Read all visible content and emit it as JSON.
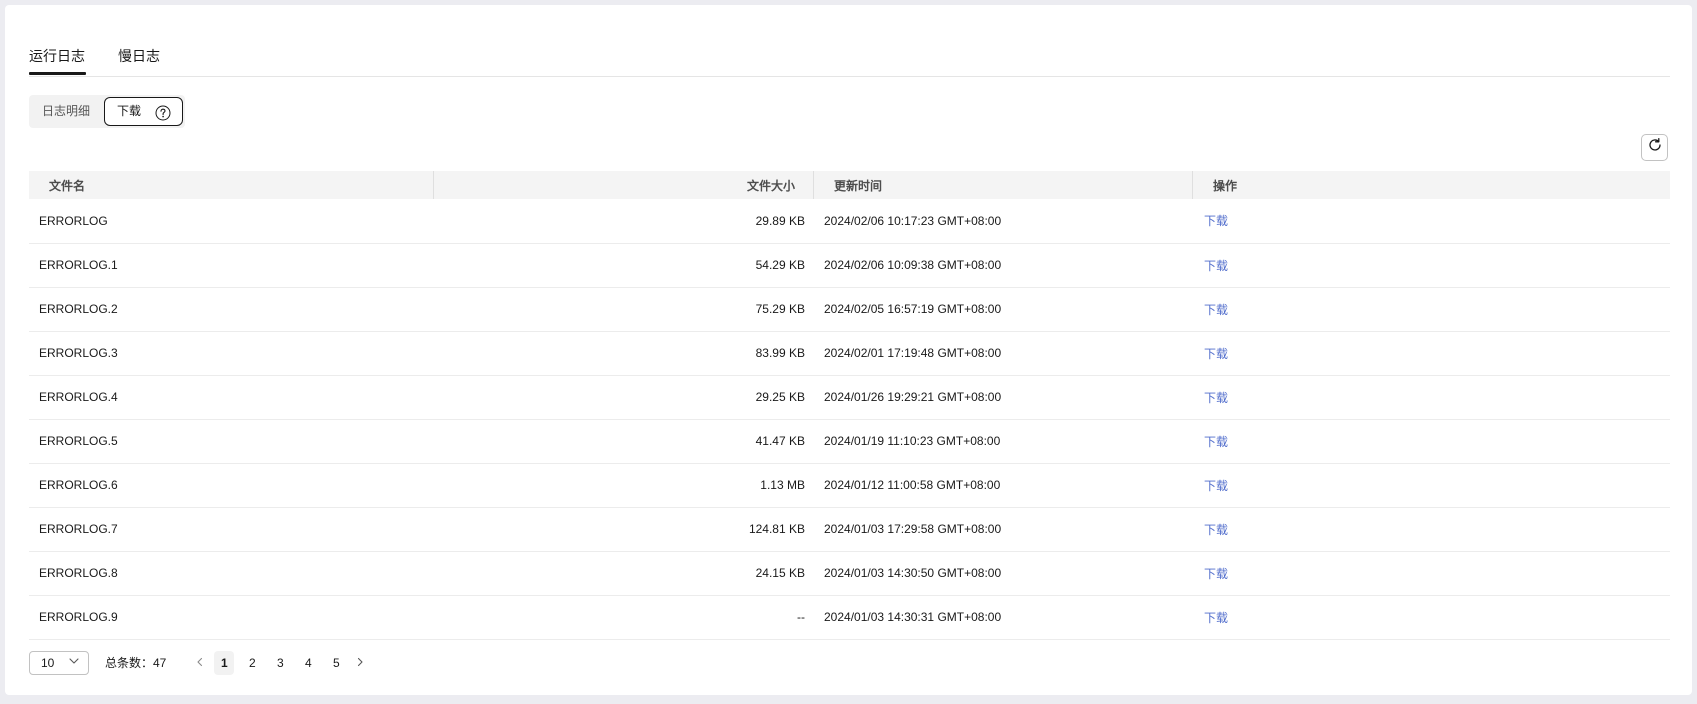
{
  "tabs": [
    {
      "label": "运行日志",
      "active": true
    },
    {
      "label": "慢日志",
      "active": false
    }
  ],
  "segment": {
    "items": [
      "日志明细",
      "下载"
    ],
    "selected": "下载"
  },
  "table": {
    "headers": {
      "name": "文件名",
      "size": "文件大小",
      "time": "更新时间",
      "op": "操作"
    },
    "rows": [
      {
        "name": "ERRORLOG",
        "size": "29.89 KB",
        "time": "2024/02/06 10:17:23 GMT+08:00",
        "op": "下载"
      },
      {
        "name": "ERRORLOG.1",
        "size": "54.29 KB",
        "time": "2024/02/06 10:09:38 GMT+08:00",
        "op": "下载"
      },
      {
        "name": "ERRORLOG.2",
        "size": "75.29 KB",
        "time": "2024/02/05 16:57:19 GMT+08:00",
        "op": "下载"
      },
      {
        "name": "ERRORLOG.3",
        "size": "83.99 KB",
        "time": "2024/02/01 17:19:48 GMT+08:00",
        "op": "下载"
      },
      {
        "name": "ERRORLOG.4",
        "size": "29.25 KB",
        "time": "2024/01/26 19:29:21 GMT+08:00",
        "op": "下载"
      },
      {
        "name": "ERRORLOG.5",
        "size": "41.47 KB",
        "time": "2024/01/19 11:10:23 GMT+08:00",
        "op": "下载"
      },
      {
        "name": "ERRORLOG.6",
        "size": "1.13 MB",
        "time": "2024/01/12 11:00:58 GMT+08:00",
        "op": "下载"
      },
      {
        "name": "ERRORLOG.7",
        "size": "124.81 KB",
        "time": "2024/01/03 17:29:58 GMT+08:00",
        "op": "下载"
      },
      {
        "name": "ERRORLOG.8",
        "size": "24.15 KB",
        "time": "2024/01/03 14:30:50 GMT+08:00",
        "op": "下载"
      },
      {
        "name": "ERRORLOG.9",
        "size": "--",
        "time": "2024/01/03 14:30:31 GMT+08:00",
        "op": "下载"
      }
    ]
  },
  "pagination": {
    "page_size": "10",
    "total_label": "总条数：47",
    "pages": [
      "1",
      "2",
      "3",
      "4",
      "5"
    ],
    "current": "1"
  },
  "icons": {
    "help": "help-circle-icon",
    "refresh": "refresh-icon",
    "dropdown": "chevron-down-icon",
    "prev": "chevron-left-icon",
    "next": "chevron-right-icon"
  },
  "colors": {
    "link": "#526ecc",
    "text": "#191919",
    "header_bg": "#f4f4f4",
    "page_bg": "#ececf1"
  }
}
